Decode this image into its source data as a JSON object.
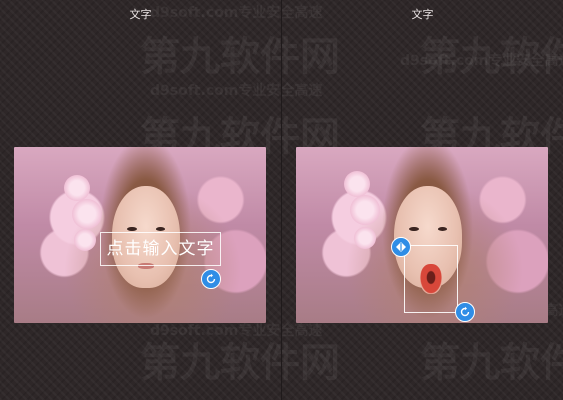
{
  "left_panel": {
    "title": "文字",
    "text_placeholder": "点击输入文字"
  },
  "right_panel": {
    "title": "文字"
  },
  "watermark": {
    "brand_text": "第九软件网",
    "url_text": "d9soft.com专业安全高速"
  },
  "icons": {
    "rotate": "rotate-icon",
    "flip": "flip-horizontal-icon"
  },
  "colors": {
    "handle_blue": "#2f8de6",
    "background": "#2e2728"
  }
}
